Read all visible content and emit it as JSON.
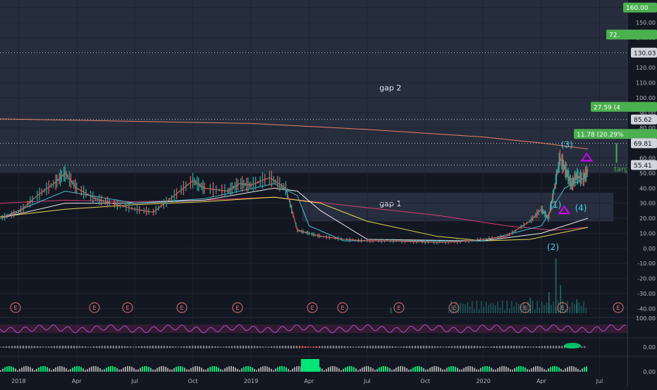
{
  "colors": {
    "background": "#131722",
    "grid": "#1f2433",
    "zone": "#2a3142",
    "candle_up": "#26a69a",
    "candle_down": "#ef5350",
    "axis_text": "#b2b5be",
    "label_green": "#4caf50",
    "wave_cyan": "#4dd0e1",
    "wave_magenta": "#d500f9",
    "rsi": "#b24ec7",
    "vol_green": "#00e676",
    "vol_gray": "#9e9e9e",
    "earnings": "#e57373"
  },
  "chart_data": {
    "type": "line",
    "xlabels": [
      "2018",
      "Apr",
      "Jul",
      "Oct",
      "2019",
      "Apr",
      "Jul",
      "Oct",
      "2020",
      "Apr",
      "Jul"
    ],
    "ylim": [
      -45,
      165
    ],
    "yticks": [
      -40,
      -30,
      -20,
      -10,
      0,
      10,
      20,
      30,
      40,
      50,
      60,
      70,
      80,
      90,
      100,
      110,
      120,
      130,
      140,
      150,
      160
    ],
    "price": {
      "x": [
        2017.92,
        2018.0,
        2018.08,
        2018.16,
        2018.2,
        2018.25,
        2018.33,
        2018.4,
        2018.5,
        2018.58,
        2018.67,
        2018.75,
        2018.8,
        2018.9,
        2018.95,
        2019.0,
        2019.08,
        2019.15,
        2019.2,
        2019.25,
        2019.3,
        2019.4,
        2019.5,
        2019.6,
        2019.7,
        2019.8,
        2019.9,
        2020.0,
        2020.1,
        2020.2,
        2020.25,
        2020.28,
        2020.3,
        2020.33,
        2020.36,
        2020.38,
        2020.4,
        2020.43,
        2020.45
      ],
      "y": [
        20,
        24,
        35,
        44,
        50,
        40,
        33,
        30,
        26,
        24,
        35,
        45,
        40,
        38,
        43,
        42,
        47,
        40,
        12,
        10,
        8,
        6,
        5,
        5,
        4.5,
        4,
        4.5,
        6,
        8,
        18,
        26,
        20,
        35,
        60,
        50,
        42,
        48,
        46,
        52
      ]
    },
    "moving_averages": [
      {
        "color": "#ec407a",
        "x": [
          2017.92,
          2018.2,
          2018.5,
          2018.8,
          2019.1,
          2019.5,
          2019.8,
          2020.1,
          2020.3,
          2020.45
        ],
        "y": [
          30,
          32,
          31,
          32,
          34,
          27,
          22,
          15,
          12,
          14
        ]
      },
      {
        "color": "#ffee58",
        "x": [
          2017.92,
          2018.2,
          2018.5,
          2018.8,
          2019.1,
          2019.3,
          2019.5,
          2019.8,
          2020.0,
          2020.2,
          2020.45
        ],
        "y": [
          21,
          26,
          29,
          31,
          34,
          30,
          18,
          8,
          5,
          6,
          14
        ]
      },
      {
        "color": "#ffffff",
        "x": [
          2017.92,
          2018.2,
          2018.5,
          2018.8,
          2019.1,
          2019.2,
          2019.3,
          2019.5,
          2020.0,
          2020.25,
          2020.45
        ],
        "y": [
          20,
          30,
          30,
          32,
          40,
          38,
          25,
          6,
          5,
          10,
          20
        ]
      },
      {
        "color": "#4dd0e1",
        "x": [
          2017.92,
          2018.2,
          2018.5,
          2018.8,
          2019.1,
          2019.2,
          2019.25,
          2019.4,
          2020.0,
          2020.25,
          2020.35,
          2020.45
        ],
        "y": [
          20,
          38,
          30,
          33,
          43,
          35,
          15,
          5,
          5,
          15,
          40,
          48
        ]
      },
      {
        "color": "#ff8a65",
        "x": [
          2017.92,
          2019.0,
          2019.5,
          2020.0,
          2020.25,
          2020.45
        ],
        "y": [
          86,
          83,
          79,
          74,
          70,
          66
        ]
      }
    ],
    "hlines": [
      130.03,
      85.62,
      69.81,
      55.41
    ],
    "price_labels": [
      "160.00",
      "72.",
      "130.03",
      "27.59 (4",
      "85.62",
      "11.78 (20.29%",
      "69.81",
      "55.41"
    ],
    "zones": [
      {
        "label": "gap 2",
        "y0": 50,
        "y1": 165
      },
      {
        "label": "gap 1",
        "y0": 18,
        "y1": 37
      }
    ],
    "waves": [
      "(1)",
      "(2)",
      "(3)",
      "(4)"
    ],
    "target_label": "targ",
    "earnings_marker": "E",
    "oscillators": {
      "rsi_level": "100.00",
      "macd_level": "0.00",
      "volume_level": "0.00"
    }
  }
}
